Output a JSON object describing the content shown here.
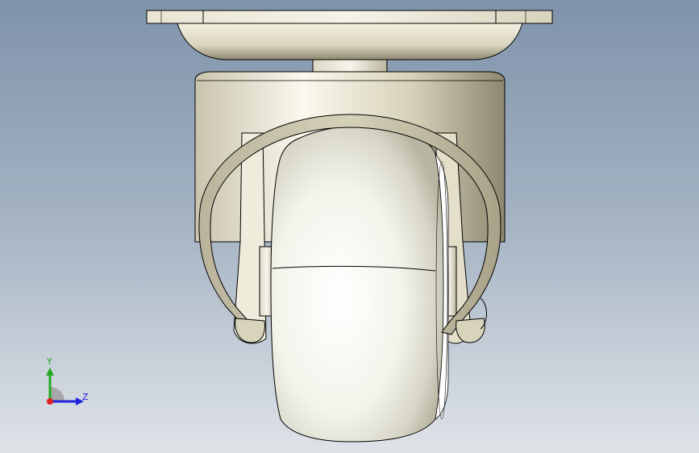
{
  "viewport": {
    "background_top": "#7f93aa",
    "background_bottom": "#dfe3e8"
  },
  "model": {
    "part_color": "#e8e4d0",
    "edge_color": "#000000"
  },
  "triad": {
    "y_label": "Y",
    "z_label": "Z",
    "y_color": "#22aa22",
    "z_color": "#2222dd",
    "x_color": "#dd2222"
  }
}
